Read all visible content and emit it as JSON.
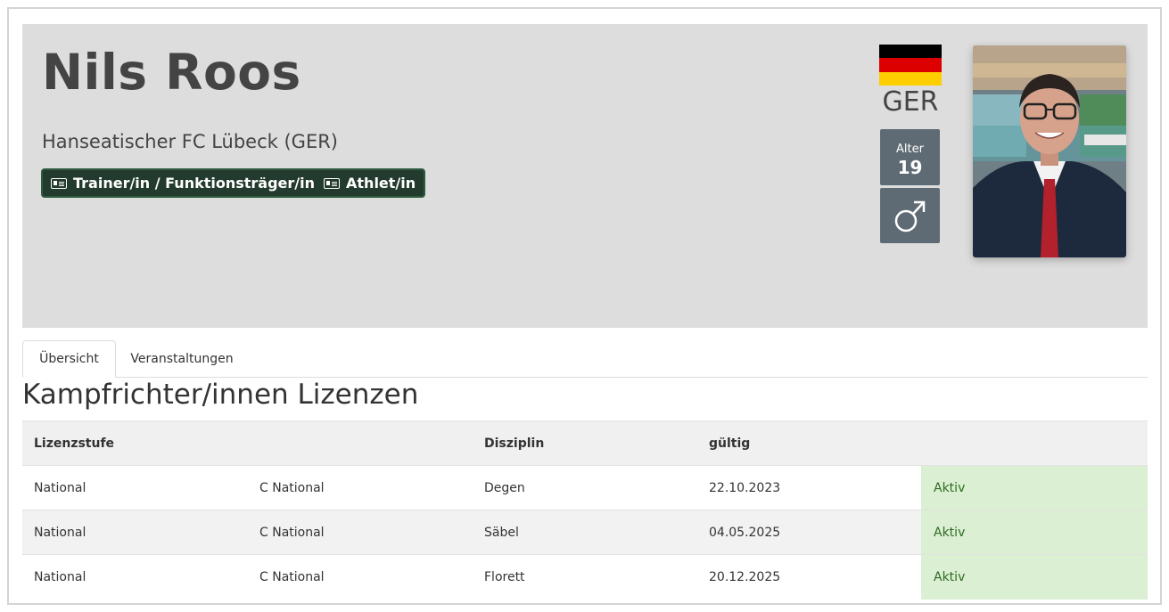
{
  "profile": {
    "name": "Nils Roos",
    "club": "Hanseatischer FC Lübeck (GER)",
    "roles": [
      "Trainer/in / Funktionsträger/in",
      "Athlet/in"
    ],
    "nation": "GER",
    "age_label": "Alter",
    "age_value": "19",
    "gender": "male",
    "flag_colors": [
      "#000000",
      "#dd0000",
      "#ffce00"
    ]
  },
  "tabs": [
    {
      "label": "Übersicht",
      "active": true
    },
    {
      "label": "Veranstaltungen",
      "active": false
    }
  ],
  "section": {
    "title": "Kampfrichter/innen Lizenzen"
  },
  "table": {
    "headers": [
      "Lizenzstufe",
      "",
      "Disziplin",
      "gültig",
      ""
    ],
    "rows": [
      [
        "National",
        "C National",
        "Degen",
        "22.10.2023",
        "Aktiv"
      ],
      [
        "National",
        "C National",
        "Säbel",
        "04.05.2025",
        "Aktiv"
      ],
      [
        "National",
        "C National",
        "Florett",
        "20.12.2025",
        "Aktiv"
      ]
    ]
  },
  "colors": {
    "hero_bg": "#dddddd",
    "badge_bg": "#5f6b74",
    "roles_bg": "#233b2e",
    "status_bg": "#dbefd3",
    "status_text": "#2f6b24"
  }
}
